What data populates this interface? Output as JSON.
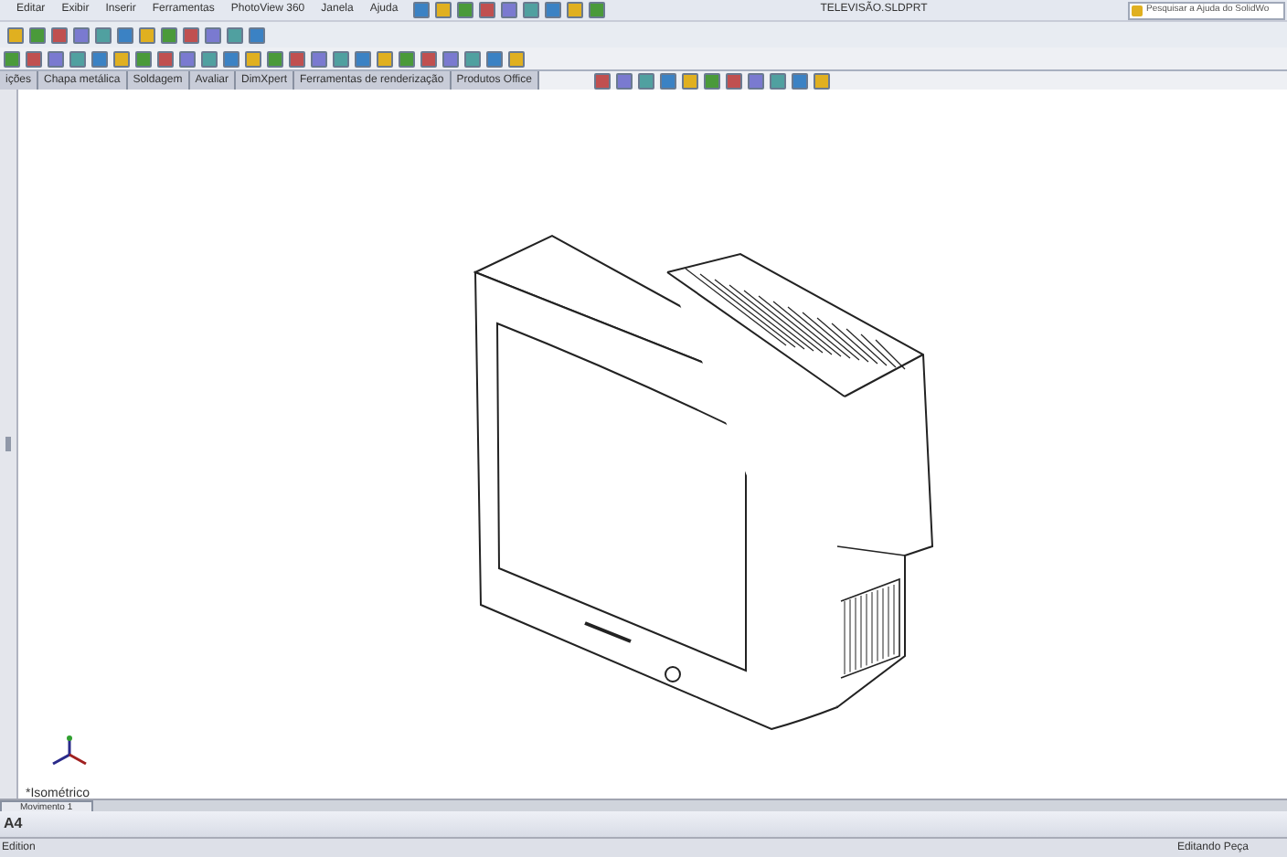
{
  "menu": [
    "Editar",
    "Exibir",
    "Inserir",
    "Ferramentas",
    "PhotoView 360",
    "Janela",
    "Ajuda"
  ],
  "window": {
    "title": "TELEVISÃO.SLDPRT"
  },
  "search": {
    "placeholder": "Pesquisar a Ajuda do SolidWo"
  },
  "tabs": [
    {
      "label": "ições",
      "selected": false
    },
    {
      "label": "Chapa metálica",
      "selected": false
    },
    {
      "label": "Soldagem",
      "selected": false
    },
    {
      "label": "Avaliar",
      "selected": false
    },
    {
      "label": "DimXpert",
      "selected": false
    },
    {
      "label": "Ferramentas de renderização",
      "selected": false
    },
    {
      "label": "Produtos Office",
      "selected": false
    }
  ],
  "view": {
    "orientation": "*Isométrico"
  },
  "bottom_tabs": [
    {
      "label": "Movimento 1",
      "selected": true
    }
  ],
  "sheet": "A4",
  "status_bar": {
    "left": "Edition",
    "right": "Editando Peça"
  }
}
